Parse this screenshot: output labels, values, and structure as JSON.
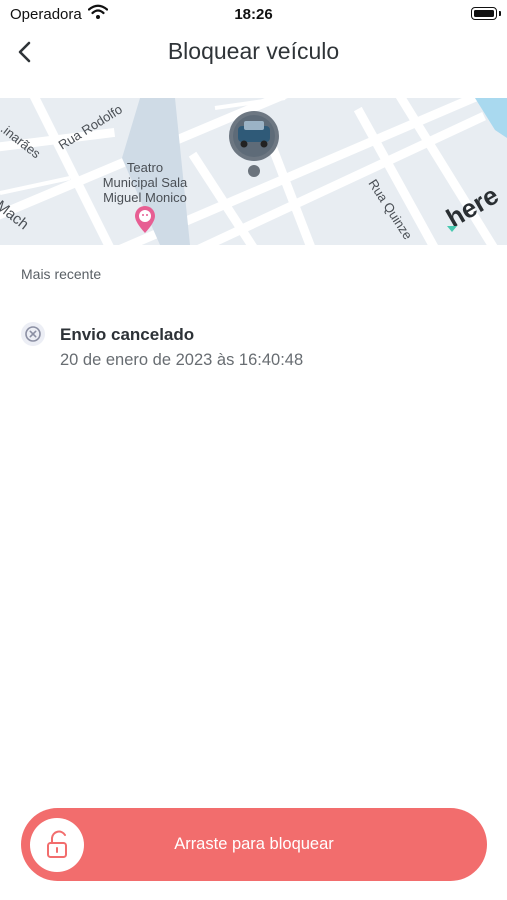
{
  "status_bar": {
    "carrier": "Operadora",
    "time": "18:26"
  },
  "nav": {
    "title": "Bloquear veículo",
    "back_icon": "chevron-left-icon"
  },
  "map": {
    "labels": {
      "street_rodolfo": "Rua Rodolfo",
      "street_guimaraes": "...inarães",
      "street_mach": "Rua Mach",
      "poi_line1": "Teatro",
      "poi_line2": "Municipal Sala",
      "poi_line3": "Miguel Monico",
      "street_quinze": "Rua Quinze",
      "brand": "here"
    },
    "icons": [
      "vehicle-marker-icon",
      "theater-pin-icon",
      "location-dot-icon"
    ]
  },
  "history": {
    "section_label": "Mais recente",
    "events": [
      {
        "title": "Envio cancelado",
        "timestamp": "20 de enero de 2023 às 16:40:48",
        "icon": "cancel-circle-icon"
      }
    ]
  },
  "slider": {
    "label": "Arraste para bloquear",
    "icon": "unlock-icon"
  },
  "colors": {
    "accent": "#f26d6d",
    "text_primary": "#2d3237",
    "text_secondary": "#686d72"
  }
}
